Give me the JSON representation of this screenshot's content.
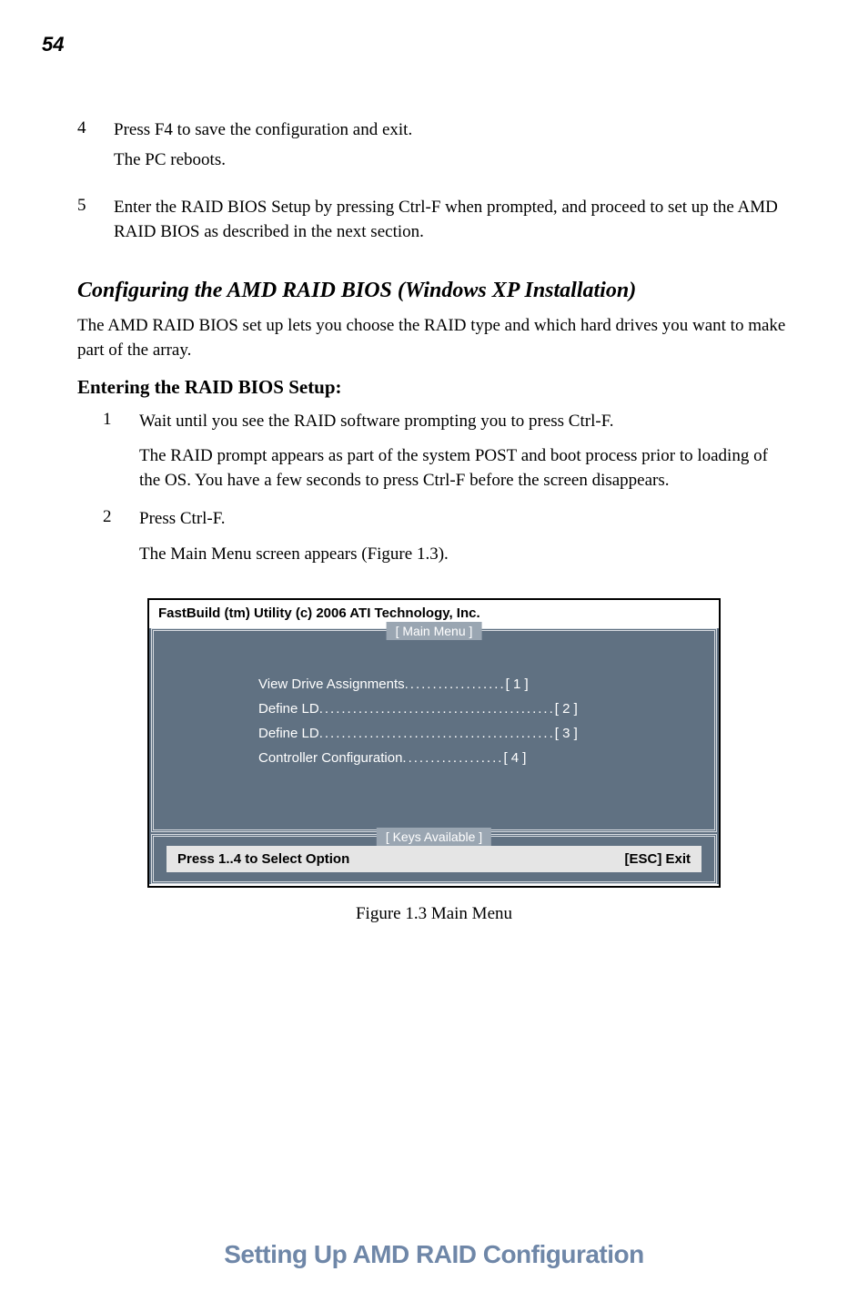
{
  "page_number": "54",
  "steps_top": [
    {
      "num": "4",
      "lines": [
        "Press F4 to save the configuration and exit.",
        "The PC reboots."
      ]
    },
    {
      "num": "5",
      "lines": [
        "Enter the RAID BIOS Setup by pressing Ctrl-F when prompted, and proceed to set up the AMD RAID BIOS as described in the next section."
      ]
    }
  ],
  "section_heading": "Configuring the AMD RAID BIOS (Windows XP Installation)",
  "section_para": "The AMD RAID BIOS set up lets you choose the RAID type and which hard drives you want to make part of the array.",
  "sub_heading": "Entering the RAID BIOS Setup:",
  "sub_steps": [
    {
      "num": "1",
      "lead": "Wait until you see the RAID software prompting you to press Ctrl-F.",
      "follow": "The RAID prompt appears as part of the system POST and boot process prior to loading of the OS. You have a few seconds to press Ctrl-F before the screen disappears."
    },
    {
      "num": "2",
      "lead": "Press Ctrl-F.",
      "follow": "The Main Menu screen appears (Figure 1.3)."
    }
  ],
  "bios": {
    "header": "FastBuild (tm) Utility (c) 2006 ATI Technology, Inc.",
    "main_title": "[  Main  Menu  ]",
    "menu": [
      {
        "label": "View Drive Assignments",
        "dots": "..................",
        "key": "[  1  ]"
      },
      {
        "label": "Define LD",
        "dots": "..........................................",
        "key": "[  2  ]"
      },
      {
        "label": "Define LD",
        "dots": "..........................................",
        "key": "[  3  ]"
      },
      {
        "label": "Controller Configuration",
        "dots": "..................",
        "key": "[  4  ]"
      }
    ],
    "keys_title": "[ Keys Available ]",
    "keys_left": "Press 1..4 to Select Option",
    "keys_right": "[ESC] Exit"
  },
  "figure_caption": "Figure 1.3    Main Menu",
  "footer": "Setting Up AMD RAID Configuration"
}
